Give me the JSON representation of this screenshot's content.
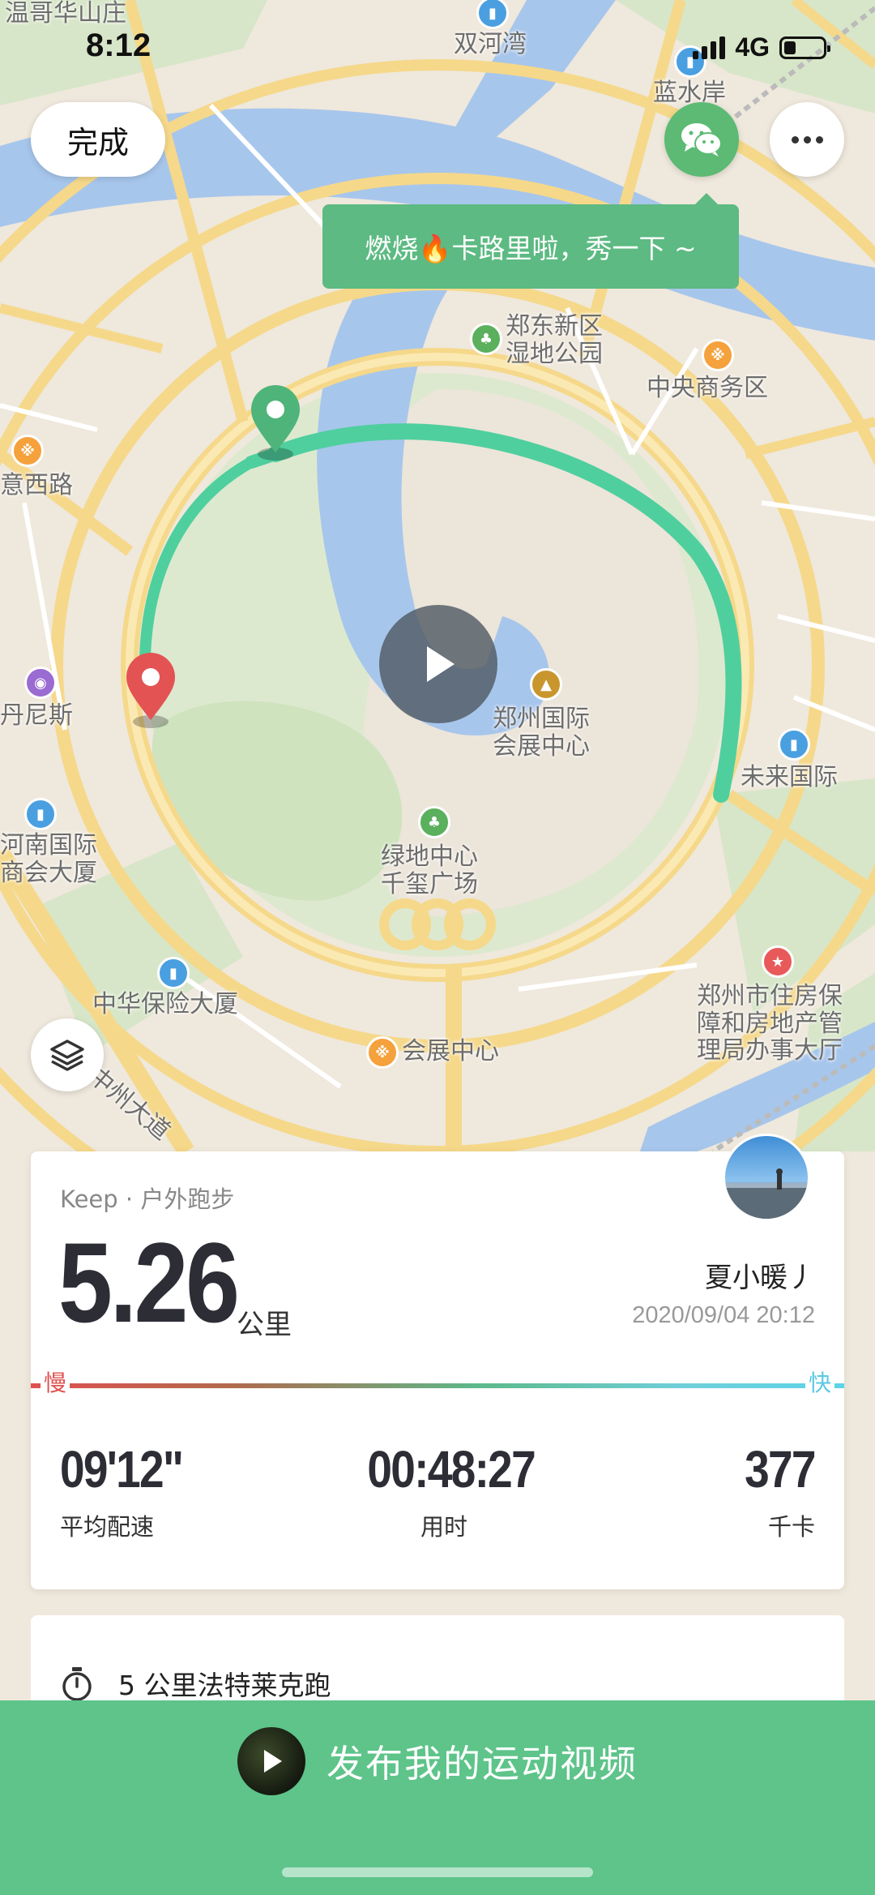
{
  "status_bar": {
    "time": "8:12",
    "network": "4G",
    "battery_level": 0.3
  },
  "map": {
    "labels": [
      "温哥华山庄",
      "双河湾",
      "蓝水岸",
      "郑东新区\n湿地公园",
      "中央商务区",
      "意西路",
      "丹尼斯",
      "郑州国际\n会展中心",
      "未来国际",
      "河南国际\n商会大厦",
      "绿地中心\n千玺广场",
      "中华保险大厦",
      "郑州市住房保\n障和房地产管\n理局办事大厅",
      "会展中心",
      "中州大道"
    ],
    "route_color": "#4fcf9e",
    "start_marker": "green-map-pin-icon",
    "end_marker": "red-map-pin-icon"
  },
  "controls": {
    "done_label": "完成",
    "share_tooltip": "燃烧🔥卡路里啦，秀一下 ~",
    "wechat_icon": "wechat-icon",
    "more_icon": "more-dots-icon",
    "play_icon": "play-icon",
    "layers_icon": "layers-icon"
  },
  "result": {
    "source": "Keep · 户外跑步",
    "distance": "5.26",
    "distance_unit": "公里",
    "username": "夏小暖丿",
    "datetime": "2020/09/04 20:12",
    "speed_slow_label": "慢",
    "speed_fast_label": "快",
    "stats": [
      {
        "value": "09'12\"",
        "label": "平均配速"
      },
      {
        "value": "00:48:27",
        "label": "用时"
      },
      {
        "value": "377",
        "label": "千卡"
      }
    ]
  },
  "achievement": {
    "icon": "stopwatch-icon",
    "text": "5 公里法特莱克跑"
  },
  "publish": {
    "label": "发布我的运动视频",
    "icon": "play-icon"
  },
  "colors": {
    "accent_green": "#5ec48a",
    "text_dark": "#2d2d36",
    "slow_red": "#e05050",
    "fast_cyan": "#5bd4e8"
  }
}
